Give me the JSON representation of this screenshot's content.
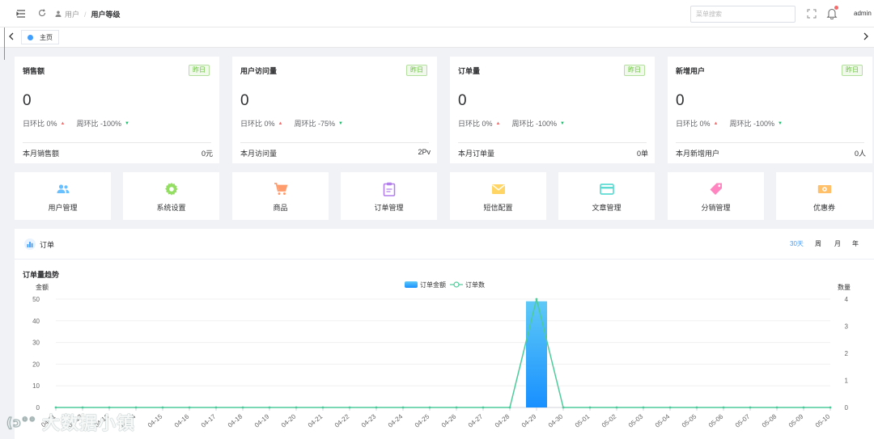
{
  "breadcrumb": {
    "parent": "用户",
    "current": "用户等级"
  },
  "header": {
    "search_placeholder": "菜单搜索",
    "user": "admin"
  },
  "tabs": [
    {
      "label": "主页"
    }
  ],
  "stat_cards": [
    {
      "title": "销售额",
      "tag": "昨日",
      "value": "0",
      "day_label": "日环比",
      "day_value": "0%",
      "week_label": "周环比",
      "week_value": "-100%",
      "footer_label": "本月销售额",
      "footer_value": "0元"
    },
    {
      "title": "用户访问量",
      "tag": "昨日",
      "value": "0",
      "day_label": "日环比",
      "day_value": "0%",
      "week_label": "周环比",
      "week_value": "-75%",
      "footer_label": "本月访问量",
      "footer_value": "2Pv"
    },
    {
      "title": "订单量",
      "tag": "昨日",
      "value": "0",
      "day_label": "日环比",
      "day_value": "0%",
      "week_label": "周环比",
      "week_value": "-100%",
      "footer_label": "本月订单量",
      "footer_value": "0单"
    },
    {
      "title": "新增用户",
      "tag": "昨日",
      "value": "0",
      "day_label": "日环比",
      "day_value": "0%",
      "week_label": "周环比",
      "week_value": "-100%",
      "footer_label": "本月新增用户",
      "footer_value": "0人"
    }
  ],
  "quick_nav": [
    {
      "label": "用户管理",
      "icon": "users-icon",
      "color": "#69c0ff"
    },
    {
      "label": "系统设置",
      "icon": "gear-icon",
      "color": "#95de64"
    },
    {
      "label": "商品",
      "icon": "cart-icon",
      "color": "#ff9c6e"
    },
    {
      "label": "订单管理",
      "icon": "clipboard-icon",
      "color": "#b37feb"
    },
    {
      "label": "短信配置",
      "icon": "mail-icon",
      "color": "#ffd666"
    },
    {
      "label": "文章管理",
      "icon": "card-icon",
      "color": "#5cdbd3"
    },
    {
      "label": "分销管理",
      "icon": "tag-icon",
      "color": "#ff85c0"
    },
    {
      "label": "优惠券",
      "icon": "money-icon",
      "color": "#ffc069"
    }
  ],
  "order_panel": {
    "title": "订单",
    "periods": [
      {
        "label": "30天",
        "active": true
      },
      {
        "label": "周",
        "active": false
      },
      {
        "label": "月",
        "active": false
      },
      {
        "label": "年",
        "active": false
      }
    ]
  },
  "watermark": "大数据小镇",
  "chart_data": {
    "type": "bar",
    "title": "订单量趋势",
    "categories": [
      "04-11",
      "04-12",
      "04-13",
      "04-14",
      "04-15",
      "04-16",
      "04-17",
      "04-18",
      "04-19",
      "04-20",
      "04-21",
      "04-22",
      "04-23",
      "04-24",
      "04-25",
      "04-26",
      "04-27",
      "04-28",
      "04-29",
      "04-30",
      "05-01",
      "05-02",
      "05-03",
      "05-04",
      "05-05",
      "05-06",
      "05-07",
      "05-08",
      "05-09",
      "05-10"
    ],
    "series": [
      {
        "name": "订单金额",
        "type": "bar",
        "axis": "left",
        "values": [
          0,
          0,
          0,
          0,
          0,
          0,
          0,
          0,
          0,
          0,
          0,
          0,
          0,
          0,
          0,
          0,
          0,
          0,
          49,
          0,
          0,
          0,
          0,
          0,
          0,
          0,
          0,
          0,
          0,
          0
        ]
      },
      {
        "name": "订单数",
        "type": "line",
        "axis": "right",
        "values": [
          0,
          0,
          0,
          0,
          0,
          0,
          0,
          0,
          0,
          0,
          0,
          0,
          0,
          0,
          0,
          0,
          0,
          0,
          4,
          0,
          0,
          0,
          0,
          0,
          0,
          0,
          0,
          0,
          0,
          0
        ]
      }
    ],
    "ylabel": "金额",
    "ylabel_right": "数量",
    "ylim": [
      0,
      50
    ],
    "yticks": [
      0,
      10,
      20,
      30,
      40,
      50
    ],
    "ylim_right": [
      0,
      4
    ],
    "yticks_right": [
      0,
      1,
      2,
      3,
      4
    ],
    "legend": "top-center",
    "colors": {
      "bar_top": "#5ec9f7",
      "bar_bottom": "#1890ff",
      "line": "#4ecb9b"
    }
  }
}
